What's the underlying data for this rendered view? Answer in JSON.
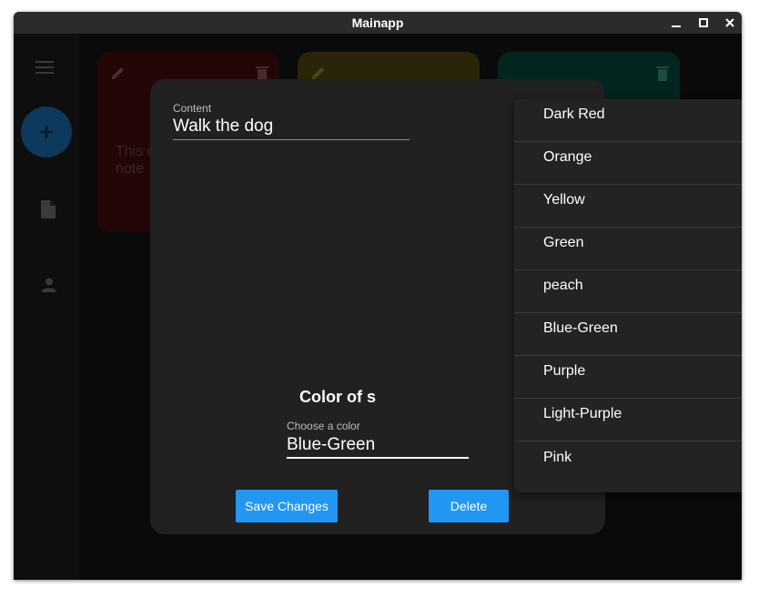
{
  "window": {
    "title": "Mainapp"
  },
  "notes": [
    {
      "text_line1": "This c",
      "text_line2": "note"
    }
  ],
  "dialog": {
    "content_label": "Content",
    "content_value": "Walk the dog",
    "color_heading": "Color of s",
    "choose_label": "Choose a color",
    "choose_value": "Blue-Green",
    "save_label": "Save Changes",
    "delete_label": "Delete"
  },
  "dropdown": {
    "options": [
      "Dark Red",
      "Orange",
      "Yellow",
      "Green",
      "peach",
      "Blue-Green",
      "Purple",
      "Light-Purple",
      "Pink"
    ]
  },
  "colors": {
    "accent": "#2196f3",
    "dialog_bg": "#212121",
    "dropdown_bg": "#232323"
  }
}
